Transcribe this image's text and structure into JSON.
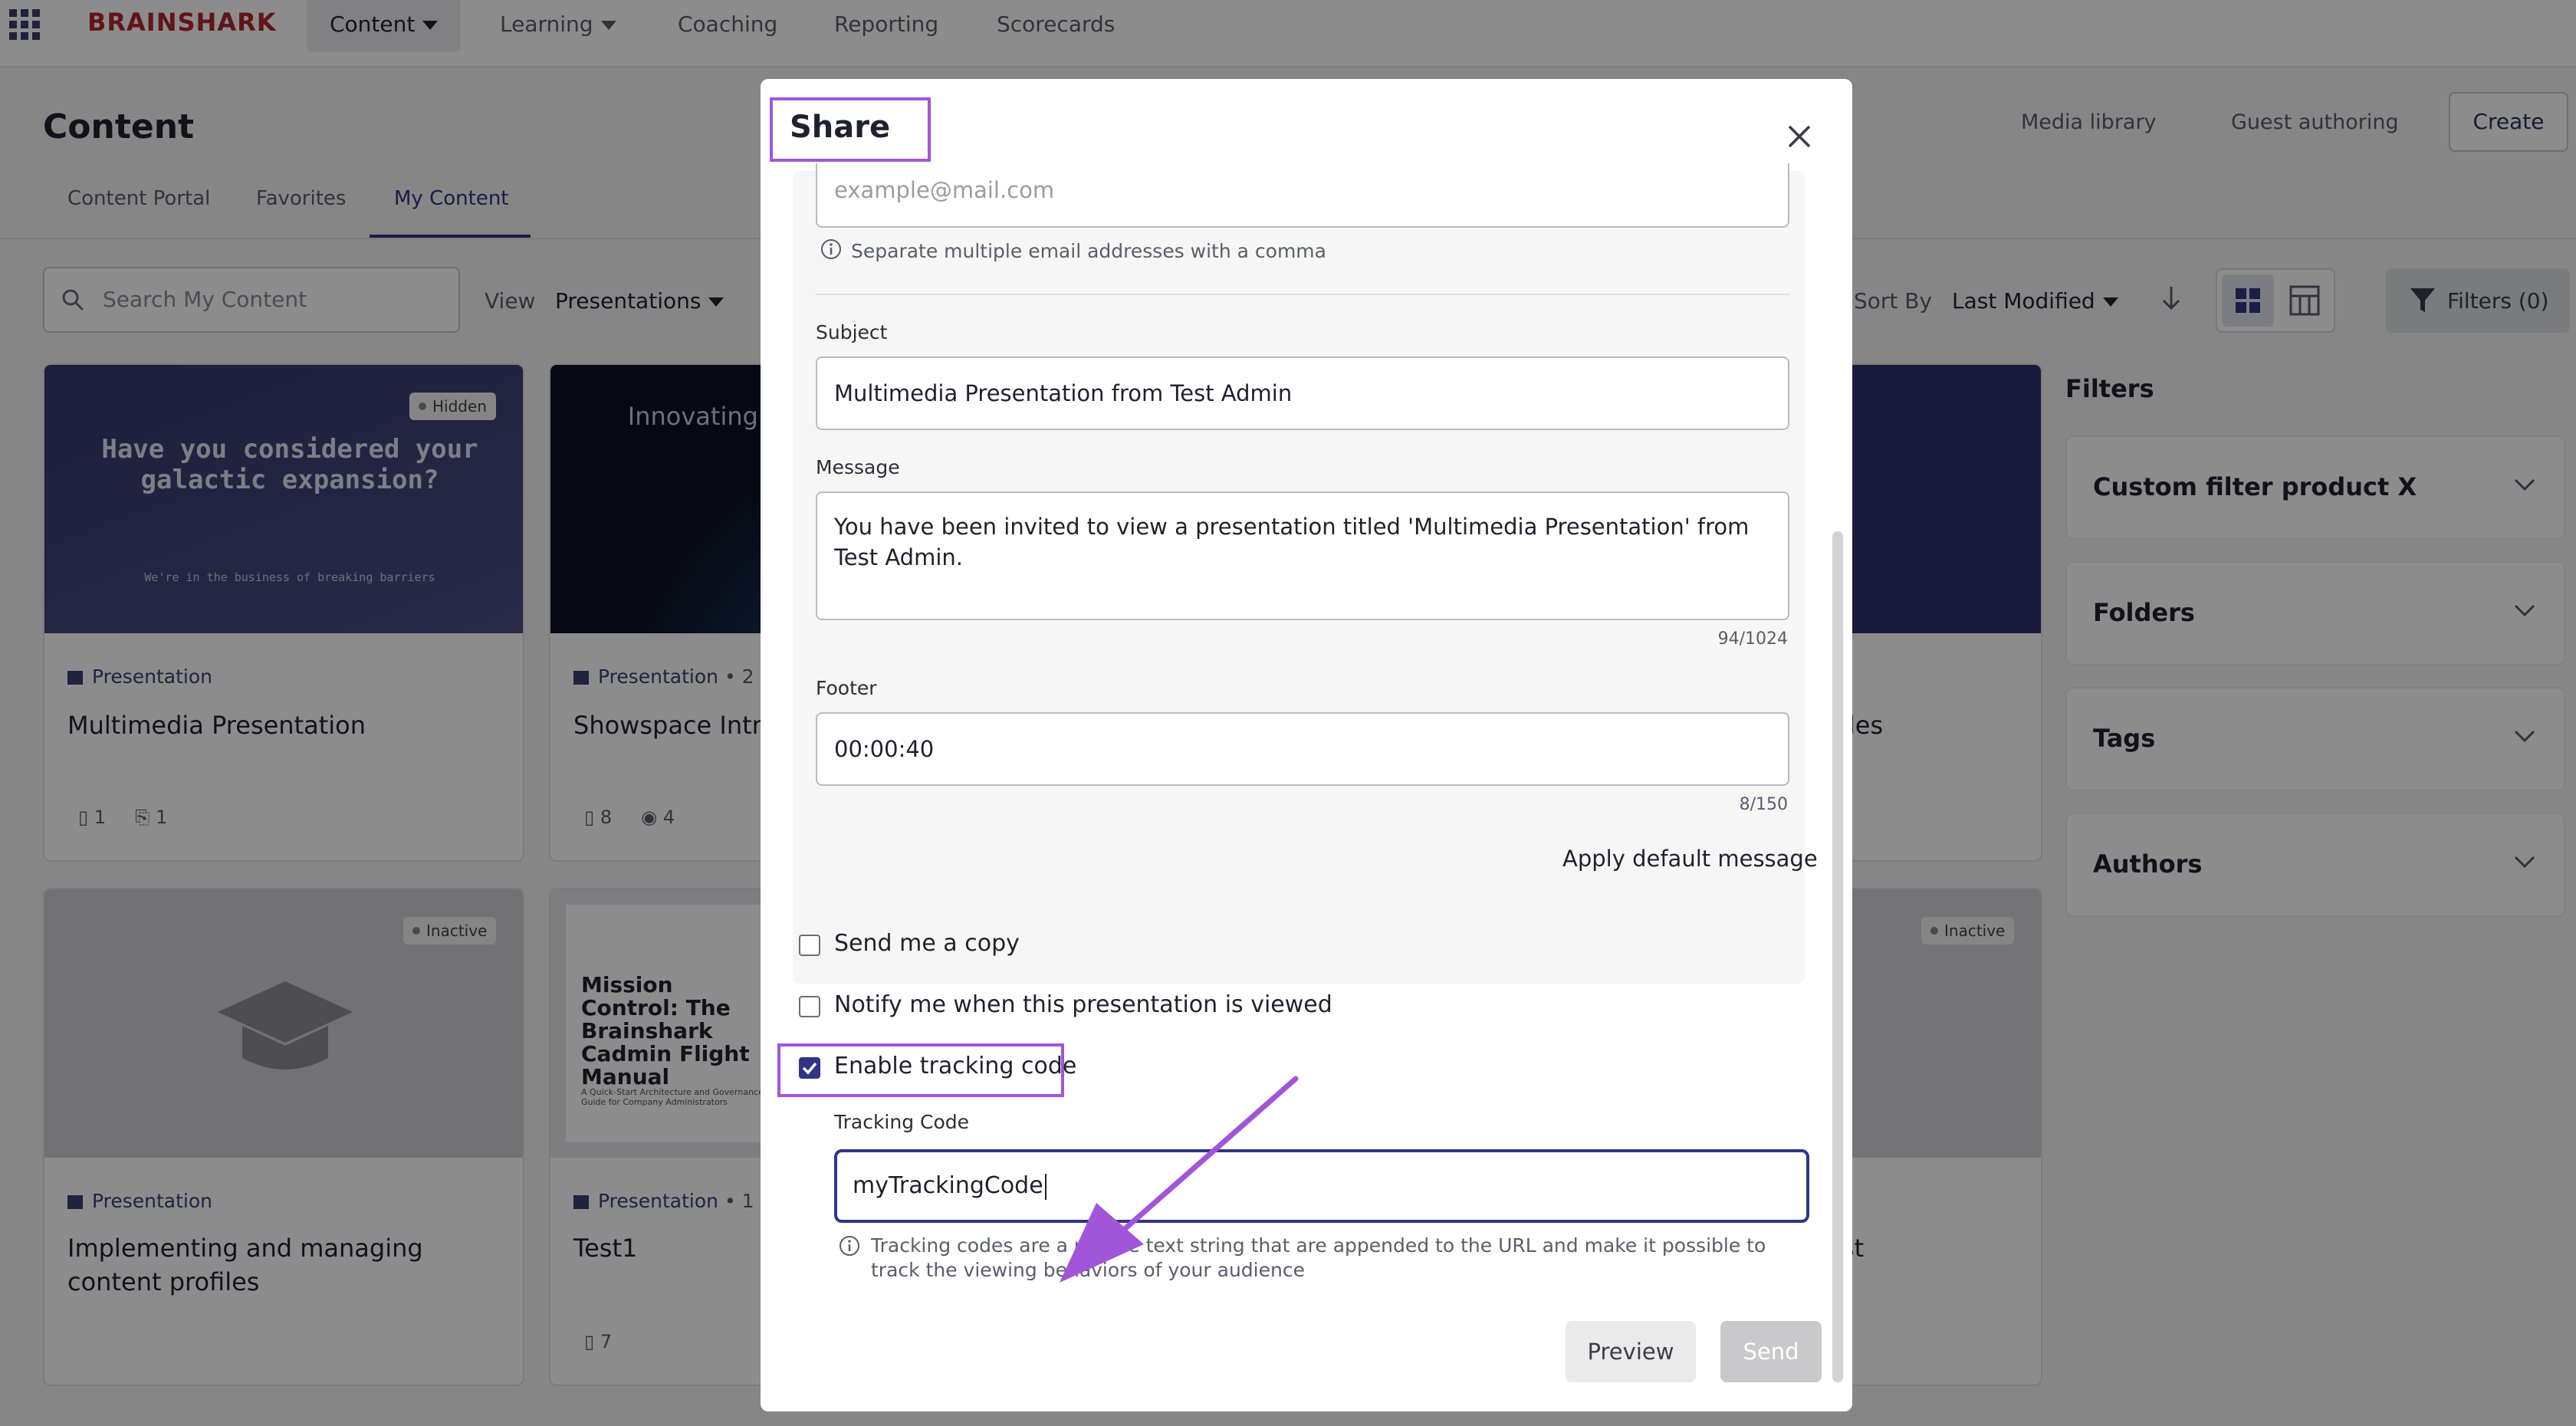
{
  "app": {
    "brand": "BRAINSHARK",
    "nav": [
      {
        "label": "Content"
      },
      {
        "label": "Learning"
      },
      {
        "label": "Coaching"
      },
      {
        "label": "Reporting"
      },
      {
        "label": "Scorecards"
      }
    ]
  },
  "page": {
    "title": "Content",
    "tabs": [
      "Content Portal",
      "Favorites",
      "My Content"
    ],
    "actions": {
      "media_library": "Media library",
      "guest_authoring": "Guest authoring",
      "create": "Create"
    },
    "search_placeholder": "Search My Content",
    "view_label": "View",
    "view_value": "Presentations",
    "sort_label": "Sort By",
    "sort_value": "Last Modified",
    "filters_button": "Filters (0)"
  },
  "cards": [
    {
      "type": "Presentation",
      "title": "Multimedia Presentation",
      "badge": "Hidden",
      "thumb_heading": "Have you considered your galactic expansion?",
      "thumb_sub": "We're in the business of breaking barriers",
      "slides": "1",
      "attachments": "1"
    },
    {
      "type": "Presentation",
      "type_extra": "• 2",
      "title": "Showspace Intro",
      "thumb_heading": "Innovating for a Bet",
      "slides": "8",
      "views": "4"
    },
    {
      "title_tail": "iles"
    },
    {
      "type": "Presentation",
      "title": "Implementing and managing content profiles",
      "badge": "Inactive"
    },
    {
      "type": "Presentation",
      "type_extra": "• 1",
      "title": "Test1",
      "thumb_heading": "Mission Control: The Brainshark Cadmin Flight Manual",
      "thumb_sub": "A Quick-Start Architecture and Governance Guide for Company Administrators",
      "slides": "7"
    },
    {
      "badge": "Inactive",
      "title_tail": "st"
    }
  ],
  "filters": {
    "title": "Filters",
    "groups": [
      "Custom filter product X",
      "Folders",
      "Tags",
      "Authors"
    ]
  },
  "modal": {
    "title": "Share",
    "email_placeholder": "example@mail.com",
    "email_hint": "Separate multiple email addresses with a comma",
    "subject_label": "Subject",
    "subject_value": "Multimedia Presentation from Test Admin",
    "message_label": "Message",
    "message_value": "You have been invited to view a presentation titled 'Multimedia Presentation' from Test Admin.",
    "message_counter": "94/1024",
    "footer_label": "Footer",
    "footer_value": "00:00:40",
    "footer_counter": "8/150",
    "apply_default": "Apply default message",
    "send_copy": "Send me a copy",
    "notify_viewed": "Notify me when this presentation is viewed",
    "enable_tracking": "Enable tracking code",
    "tracking_label": "Tracking Code",
    "tracking_value": "myTrackingCode",
    "tracking_hint": "Tracking codes are a unique text string that are appended to the URL and make it possible to track the viewing behaviors of your audience",
    "preview": "Preview",
    "send": "Send"
  },
  "colors": {
    "brand": "#b3262d",
    "accent": "#2f3584",
    "highlight": "#a155d8"
  }
}
